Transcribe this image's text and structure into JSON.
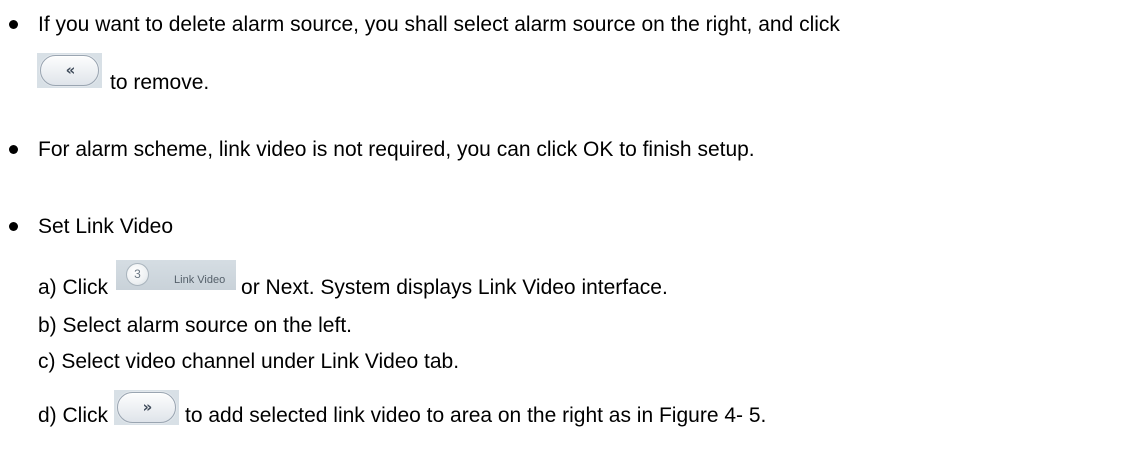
{
  "bullets": [
    {
      "text": "If you want to delete alarm source, you shall select alarm source on the right, and click"
    },
    {
      "text": "For alarm scheme, link video is not required, you can click OK to finish setup."
    },
    {
      "text": "Set Link Video"
    }
  ],
  "remove_line": {
    "button_glyph": "«",
    "text": "to remove."
  },
  "steps": [
    {
      "prefix": "a) Click",
      "suffix": "or Next. System displays Link Video interface.",
      "tab": {
        "number": "3",
        "label": "Link Video"
      }
    },
    {
      "text": "b) Select alarm source on the left."
    },
    {
      "text": "c) Select video channel under Link Video tab."
    },
    {
      "prefix": "d) Click",
      "button_glyph": "»",
      "suffix": "to add selected link video to area on the right as in Figure 4- 5."
    }
  ],
  "colors": {
    "text": "#000000",
    "button_border": "#9aa5b1",
    "tab_bg": "#c9d2d9"
  }
}
